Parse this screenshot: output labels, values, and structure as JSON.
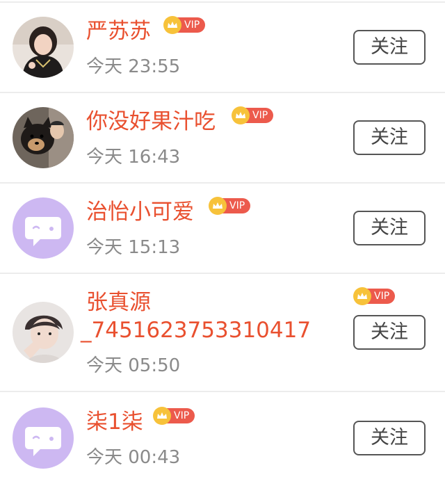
{
  "users": [
    {
      "name": "严苏苏",
      "time": "今天 23:55",
      "vip_label": "VIP",
      "follow_label": "关注",
      "avatar": "photo-girl"
    },
    {
      "name": "你没好果汁吃",
      "time": "今天 16:43",
      "vip_label": "VIP",
      "follow_label": "关注",
      "avatar": "photo-dog"
    },
    {
      "name": "治怡小可爱",
      "time": "今天 15:13",
      "vip_label": "VIP",
      "follow_label": "关注",
      "avatar": "default-chat-bubble"
    },
    {
      "name_line1": "张真源",
      "name_line2": "_7451623753310417",
      "time": "今天 05:50",
      "vip_label": "VIP",
      "follow_label": "关注",
      "avatar": "photo-boy"
    },
    {
      "name": "柒1柒",
      "time": "今天 00:43",
      "vip_label": "VIP",
      "follow_label": "关注",
      "avatar": "default-chat-bubble"
    }
  ],
  "colors": {
    "name": "#e9502f",
    "time": "#8a8a8a",
    "vip_badge": "#ec5a4c",
    "crown": "#f7c23a",
    "default_avatar_bg": "#cdb8f2"
  }
}
